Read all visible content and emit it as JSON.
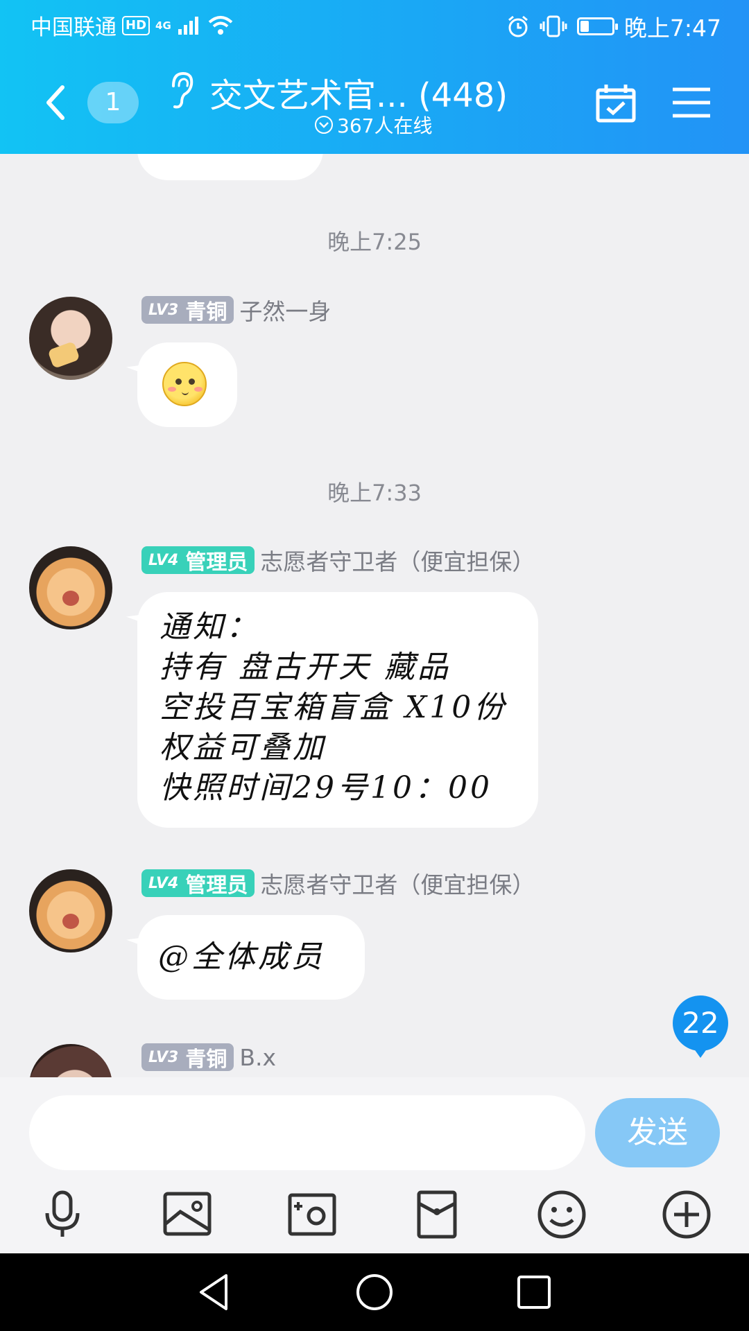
{
  "status_bar": {
    "carrier": "中国联通",
    "hd": "HD",
    "network": "4G",
    "time": "晚上7:47"
  },
  "header": {
    "unread_count": "1",
    "title": "交文艺术官... (448)",
    "online_text": "367人在线"
  },
  "messages": [
    {
      "time": "晚上7:25",
      "level": "LV3",
      "rank": "青铜",
      "sender": "子然一身",
      "content": ""
    },
    {
      "time": "晚上7:33",
      "level": "LV4",
      "rank": "管理员",
      "sender": "志愿者守卫者（便宜担保）",
      "lines": [
        "通知：",
        "持有 盘古开天 藏品",
        "空投百宝箱盲盒 X10份",
        "权益可叠加",
        "快照时间29号10：00"
      ]
    },
    {
      "level": "LV4",
      "rank": "管理员",
      "sender": "志愿者守卫者（便宜担保）",
      "content": "@全体成员"
    },
    {
      "level": "LV3",
      "rank": "青铜",
      "sender": "B.x"
    }
  ],
  "new_message_badge": "22",
  "input": {
    "placeholder": "",
    "send_label": "发送"
  },
  "toolbar_icons": [
    "microphone-icon",
    "image-icon",
    "camera-icon",
    "red-packet-icon",
    "emoji-icon",
    "plus-icon"
  ],
  "colors": {
    "header": "#1aa8f5",
    "admin_badge": "#38d1b9",
    "bronze_badge": "#a8adbd",
    "send": "#86c8f6",
    "badge": "#1493f0"
  }
}
